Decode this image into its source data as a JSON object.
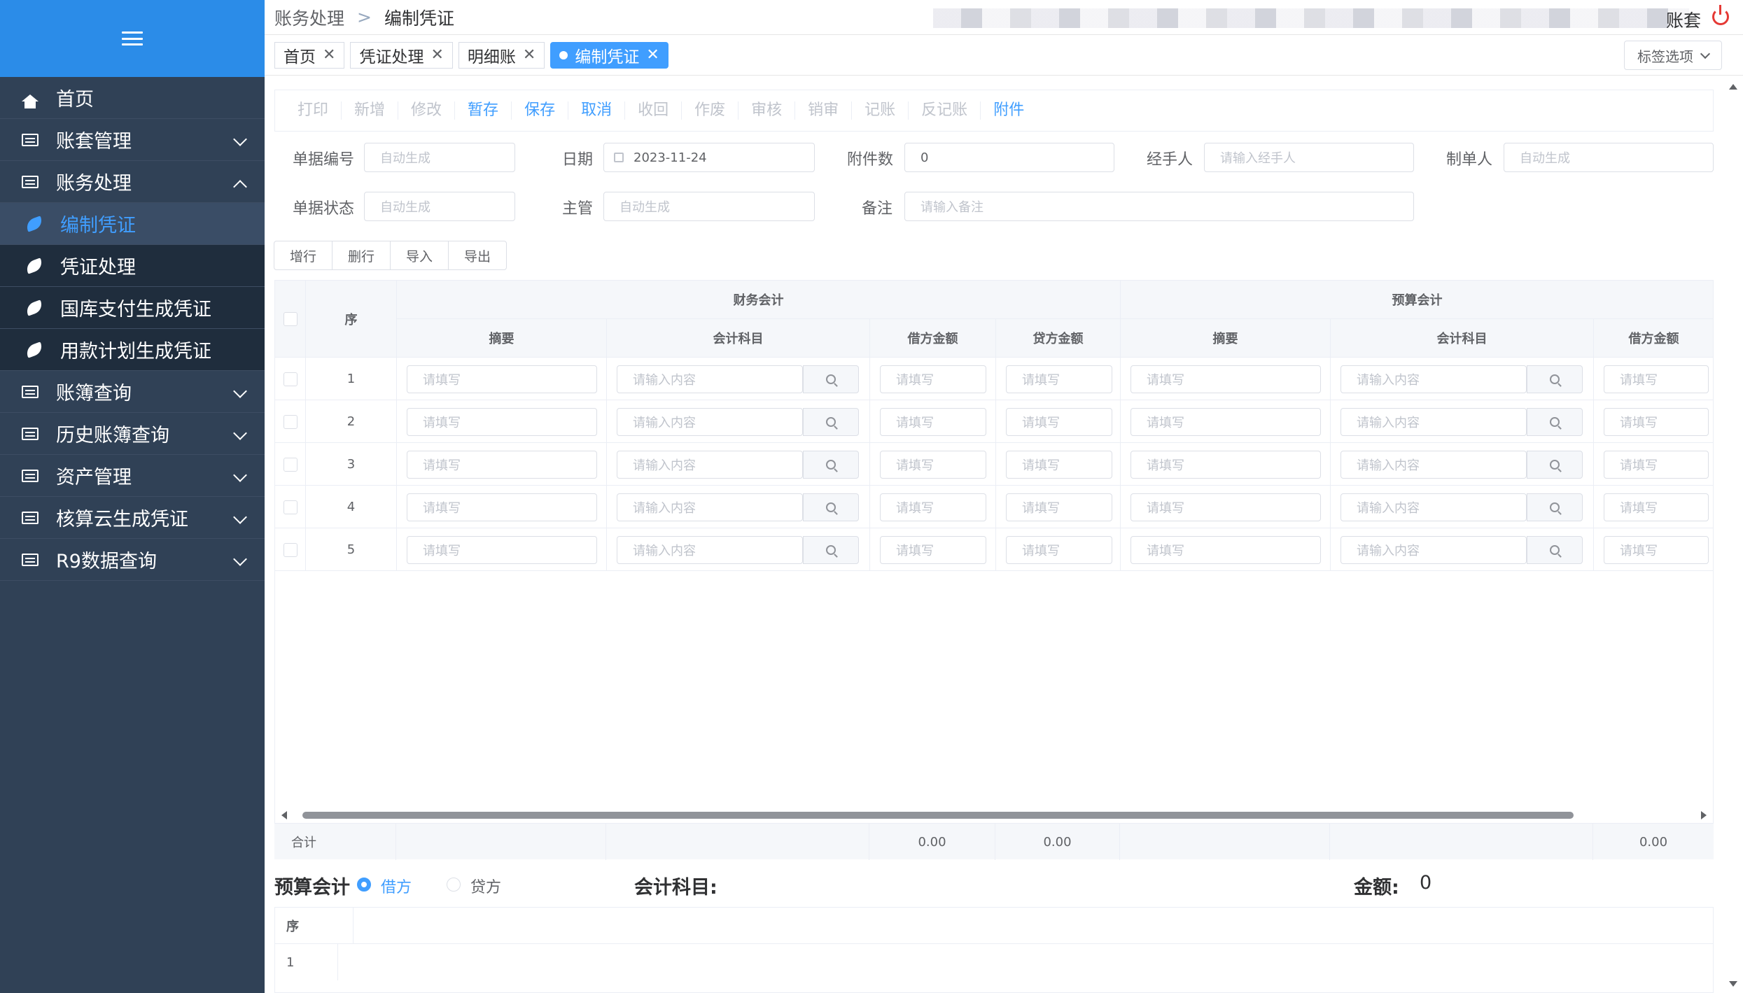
{
  "sidebar": {
    "items": [
      {
        "label": "首页",
        "icon": "home-icon"
      },
      {
        "label": "账套管理",
        "icon": "list-icon"
      },
      {
        "label": "账务处理",
        "icon": "list-icon"
      },
      {
        "label": "编制凭证",
        "icon": "leaf-icon"
      },
      {
        "label": "凭证处理",
        "icon": "leaf-icon"
      },
      {
        "label": "国库支付生成凭证",
        "icon": "leaf-icon"
      },
      {
        "label": "用款计划生成凭证",
        "icon": "leaf-icon"
      },
      {
        "label": "账簿查询",
        "icon": "list-icon"
      },
      {
        "label": "历史账簿查询",
        "icon": "list-icon"
      },
      {
        "label": "资产管理",
        "icon": "list-icon"
      },
      {
        "label": "核算云生成凭证",
        "icon": "list-icon"
      },
      {
        "label": "R9数据查询",
        "icon": "list-icon"
      }
    ]
  },
  "breadcrumb": {
    "parent": "账务处理",
    "sep": ">",
    "current": "编制凭证"
  },
  "header": {
    "account_label": "账套"
  },
  "tabs": [
    {
      "label": "首页"
    },
    {
      "label": "凭证处理"
    },
    {
      "label": "明细账"
    },
    {
      "label": "编制凭证"
    }
  ],
  "tab_options": "标签选项",
  "toolbar": [
    "打印",
    "新增",
    "修改",
    "暂存",
    "保存",
    "取消",
    "收回",
    "作废",
    "审核",
    "销审",
    "记账",
    "反记账",
    "附件"
  ],
  "form": {
    "doc_no_label": "单据编号",
    "doc_no_placeholder": "自动生成",
    "date_label": "日期",
    "date_value": "2023-11-24",
    "attach_label": "附件数",
    "attach_value": "0",
    "handler_label": "经手人",
    "handler_placeholder": "请输入经手人",
    "maker_label": "制单人",
    "maker_placeholder": "自动生成",
    "status_label": "单据状态",
    "status_placeholder": "自动生成",
    "supervisor_label": "主管",
    "supervisor_placeholder": "自动生成",
    "remark_label": "备注",
    "remark_placeholder": "请输入备注"
  },
  "row_buttons": [
    "增行",
    "删行",
    "导入",
    "导出"
  ],
  "grid": {
    "group_finance": "财务会计",
    "group_budget": "预算会计",
    "col_seq": "序",
    "col_summary": "摘要",
    "col_account": "会计科目",
    "col_debit": "借方金额",
    "col_credit": "贷方金额",
    "placeholder_fill": "请填写",
    "placeholder_input": "请输入内容",
    "rows": [
      "1",
      "2",
      "3",
      "4",
      "5"
    ],
    "sum_label": "合计",
    "sum_fin_debit": "0.00",
    "sum_fin_credit": "0.00",
    "sum_bud_debit": "0.00"
  },
  "bottom": {
    "title": "预算会计",
    "radio_debit": "借方",
    "radio_credit": "贷方",
    "account_label": "会计科目:",
    "amount_label": "金额:",
    "amount_value": "0",
    "col_seq": "序",
    "row1": "1"
  },
  "colors": {
    "primary": "#409eff",
    "sidebar_bg": "#304156",
    "sidebar_top": "#2b8ce8"
  }
}
